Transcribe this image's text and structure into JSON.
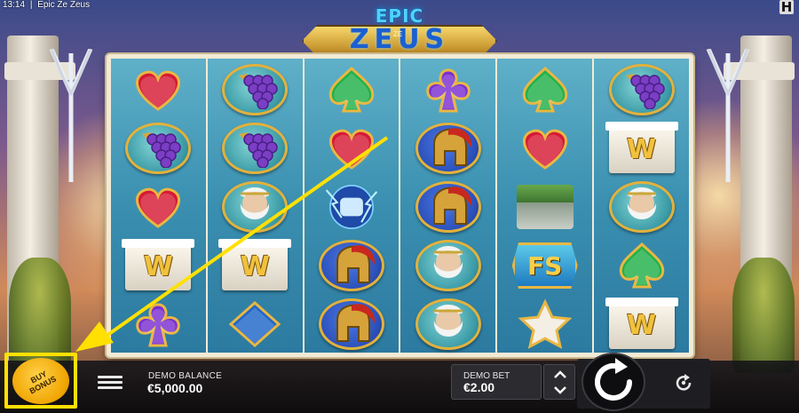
{
  "topbar": {
    "time": "13:14",
    "separator": "|",
    "title": "Epic Ze Zeus"
  },
  "brand_mark": "H",
  "logo": {
    "line1": "EPIC",
    "small": "ZE",
    "line2": "ZEUS"
  },
  "colors": {
    "accent_yellow": "#ffe000",
    "reel_blue": "#3a8fb0",
    "gold": "#e2b13c"
  },
  "reels": [
    [
      "heart-gem",
      "grapes-medal",
      "heart-gem",
      "w-temple",
      "purple-clover-gem"
    ],
    [
      "grapes-medal",
      "grapes-medal",
      "zeus-medal",
      "w-temple",
      "blue-diamond-gem"
    ],
    [
      "green-spade-gem",
      "heart-gem",
      "thunder-fist-wild",
      "spartan-helmet-medal",
      "spartan-helmet-medal"
    ],
    [
      "purple-clover-gem",
      "spartan-helmet-medal",
      "spartan-helmet-medal",
      "zeus-medal",
      "zeus-medal"
    ],
    [
      "green-spade-gem",
      "heart-gem",
      "temple-ruins",
      "fs-scatter",
      "star-gem"
    ],
    [
      "grapes-medal",
      "w-temple",
      "zeus-medal",
      "green-spade-gem",
      "w-temple"
    ]
  ],
  "symbols": {
    "w_letter": "W",
    "fs_text": "FS"
  },
  "bottombar": {
    "buy_bonus_label": "BUY BONUS",
    "balance_label": "DEMO BALANCE",
    "balance_value": "€5,000.00",
    "bet_label": "DEMO BET",
    "bet_value": "€2.00"
  }
}
